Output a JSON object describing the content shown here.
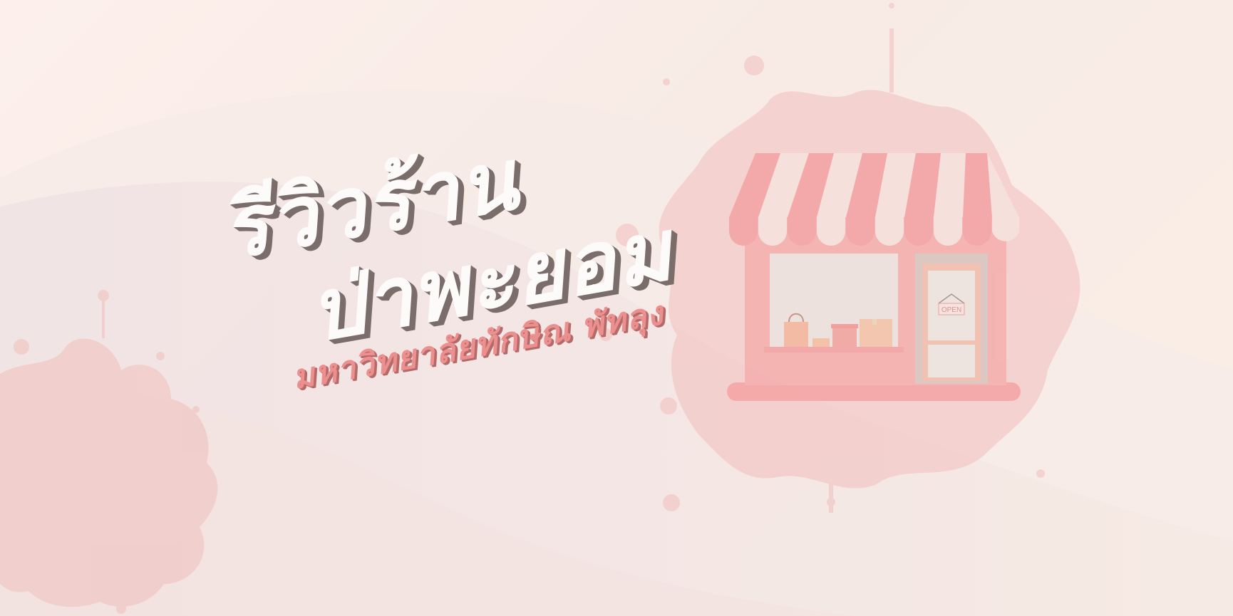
{
  "banner": {
    "title_line1": "รีวิวร้าน",
    "title_line2": "ป่าพะยอม",
    "subtitle": "มหาวิทยาลัยทักษิณ พัทลุง"
  },
  "shop": {
    "sign_text": "OPEN"
  },
  "colors": {
    "background": "#f8ebe6",
    "splash": "#f2c5c5",
    "awning_pink": "#f3a4a4",
    "awning_white": "#f7e7e2",
    "title_text": "#fdfbfa",
    "title_shadow": "#7a6d6a",
    "subtitle_text": "#ec8f8f"
  },
  "icons": {
    "shop": "storefront-icon",
    "bag": "shopping-bag-icon",
    "sign": "open-sign-icon"
  }
}
